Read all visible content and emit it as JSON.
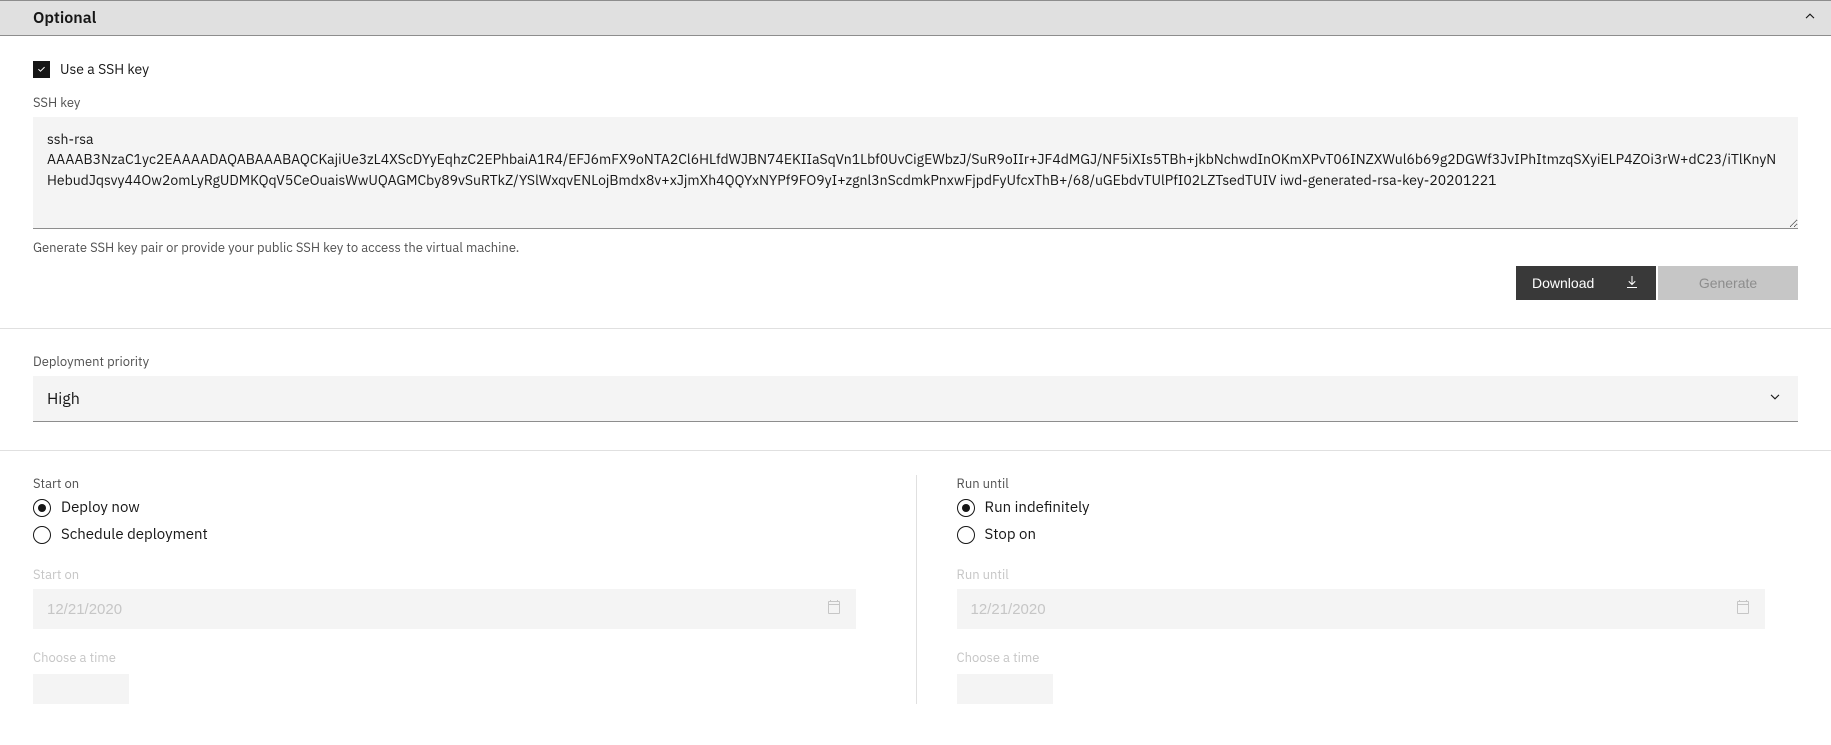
{
  "accordion": {
    "title": "Optional"
  },
  "ssh": {
    "checkbox_label": "Use a SSH key",
    "field_label": "SSH key",
    "value": "ssh-rsa AAAAB3NzaC1yc2EAAAADAQABAAABAQCKajiUe3zL4XScDYyEqhzC2EPhbaiA1R4/EFJ6mFX9oNTA2Cl6HLfdWJBN74EKIIaSqVn1Lbf0UvCigEWbzJ/SuR9oIIr+JF4dMGJ/NF5iXIs5TBh+jkbNchwdInOKmXPvT06INZXWul6b69g2DGWf3JvIPhItmzqSXyiELP4ZOi3rW+dC23/iTlKnyNHebudJqsvy44Ow2omLyRgUDMKQqV5CeOuaisWwUQAGMCby89vSuRTkZ/YSlWxqvENLojBmdx8v+xJjmXh4QQYxNYPf9FO9yI+zgnl3nScdmkPnxwFjpdFyUfcxThB+/68/uGEbdvTUlPfI02LZTsedTUIV iwd-generated-rsa-key-20201221",
    "helper": "Generate SSH key pair or provide your public SSH key to access the virtual machine.",
    "download": "Download",
    "generate": "Generate"
  },
  "priority": {
    "label": "Deployment priority",
    "value": "High"
  },
  "start": {
    "label": "Start on",
    "opt_now": "Deploy now",
    "opt_schedule": "Schedule deployment",
    "date_label": "Start on",
    "date_placeholder": "12/21/2020",
    "time_label": "Choose a time"
  },
  "run": {
    "label": "Run until",
    "opt_indef": "Run indefinitely",
    "opt_stop": "Stop on",
    "date_label": "Run until",
    "date_placeholder": "12/21/2020",
    "time_label": "Choose a time"
  }
}
